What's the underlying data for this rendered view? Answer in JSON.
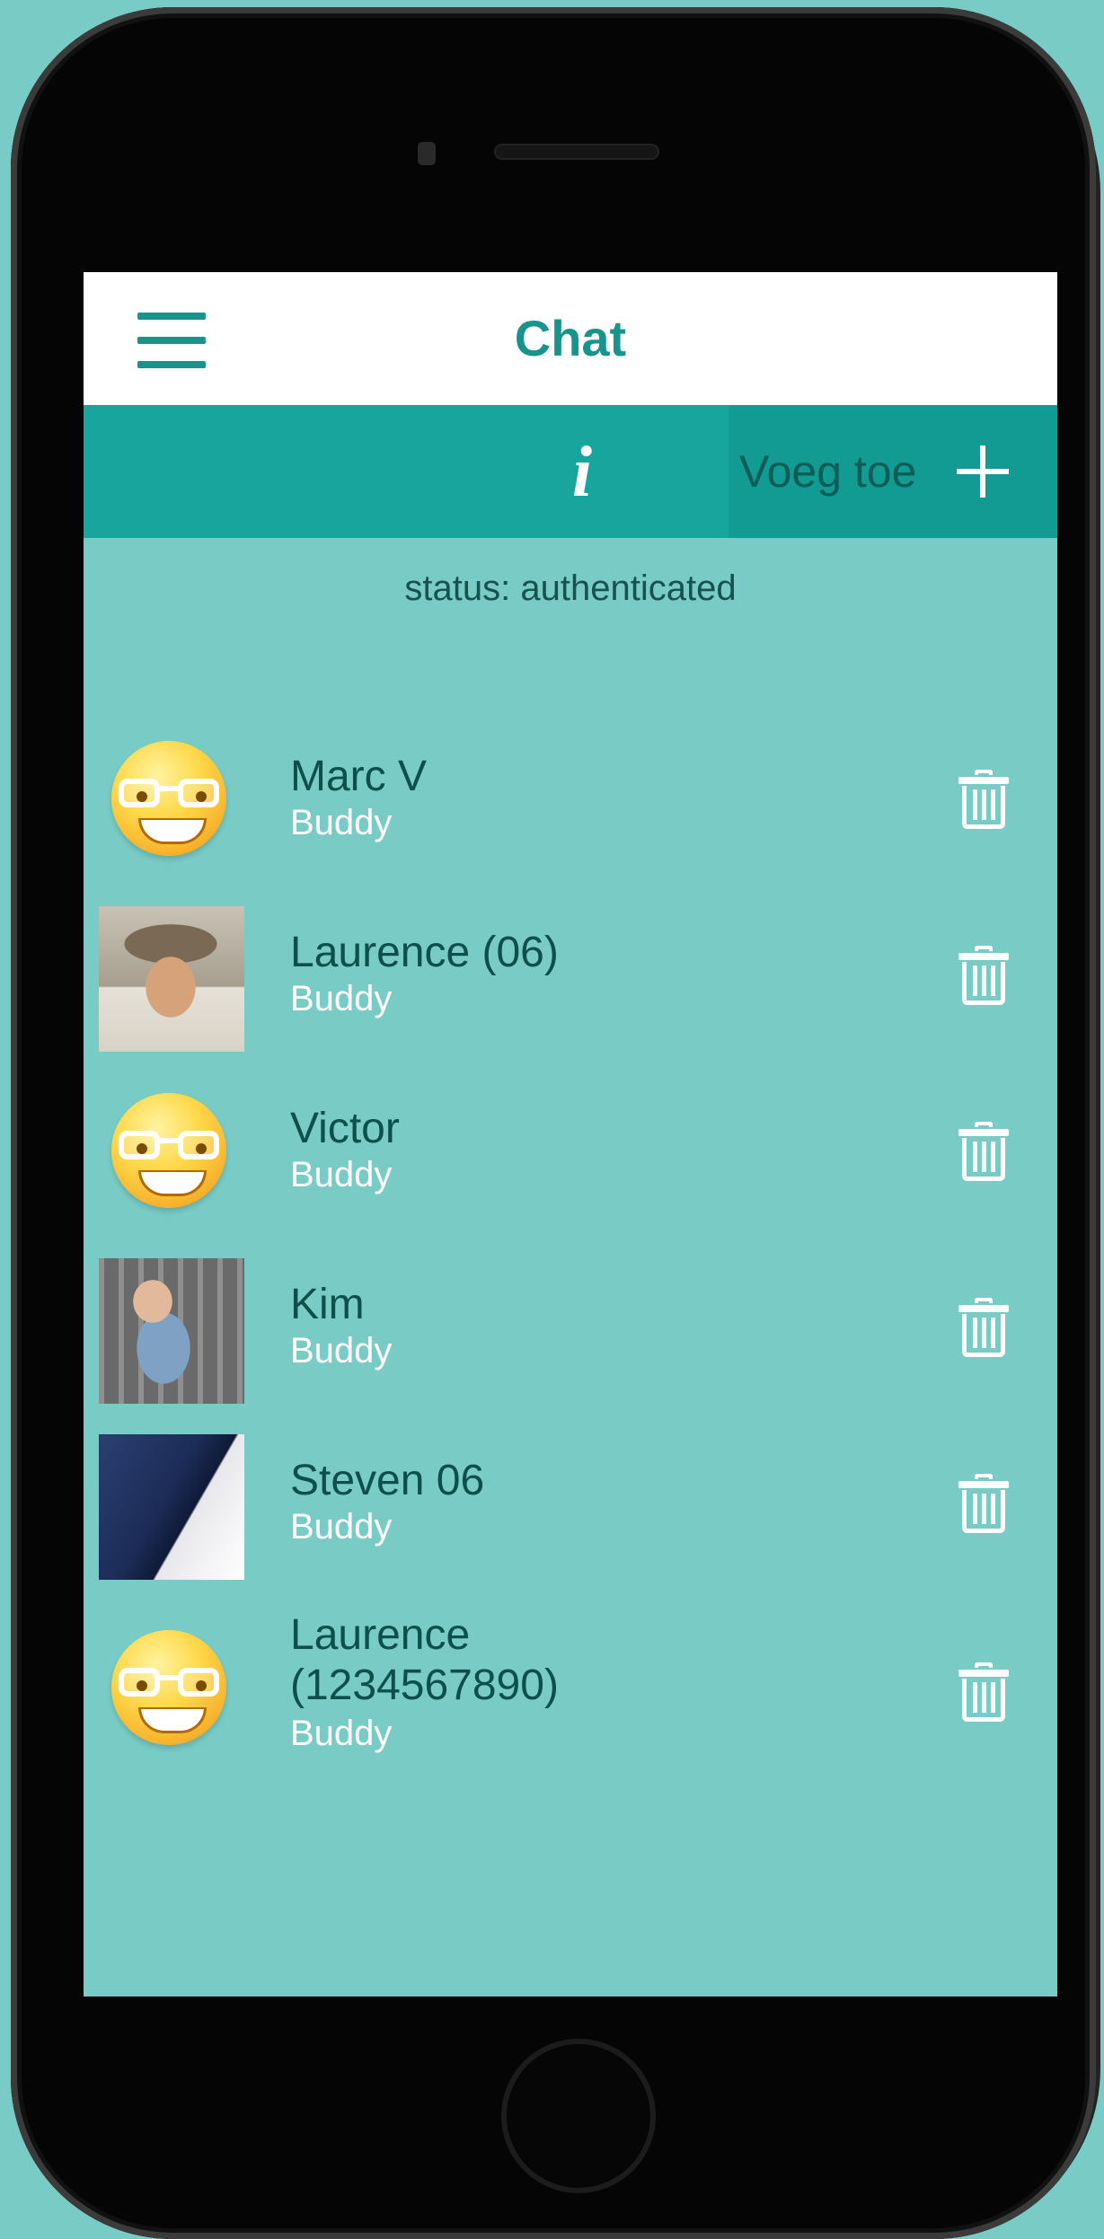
{
  "app": {
    "title": "Chat"
  },
  "toolbar": {
    "info_icon": "info-icon",
    "add_label": "Voeg toe",
    "add_icon": "plus-icon"
  },
  "status": "status: authenticated",
  "buddies": [
    {
      "name": "Marc V",
      "role": "Buddy",
      "avatar": "smiley-glasses"
    },
    {
      "name": "Laurence (06)",
      "role": "Buddy",
      "avatar": "photo"
    },
    {
      "name": "Victor",
      "role": "Buddy",
      "avatar": "smiley-glasses"
    },
    {
      "name": "Kim",
      "role": "Buddy",
      "avatar": "photo"
    },
    {
      "name": "Steven 06",
      "role": "Buddy",
      "avatar": "photo"
    },
    {
      "name": "Laurence (1234567890)",
      "role": "Buddy",
      "avatar": "smiley-glasses"
    }
  ],
  "colors": {
    "background": "#79cbc5",
    "accent": "#17958c",
    "toolbar": "#17a59d",
    "add_button": "#129b93"
  }
}
